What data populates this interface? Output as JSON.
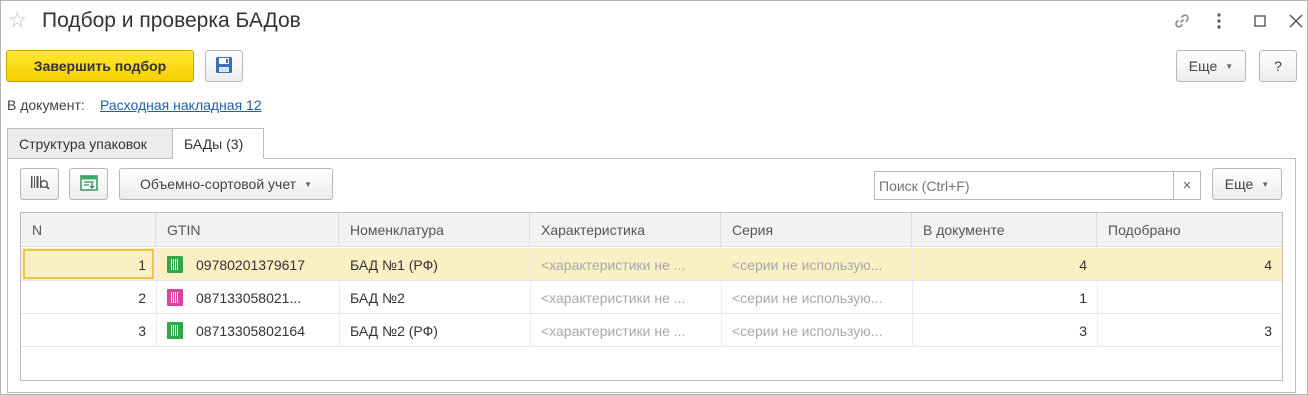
{
  "window": {
    "title": "Подбор и проверка БАДов"
  },
  "toolbar": {
    "finish_label": "Завершить подбор",
    "more_label": "Еще",
    "help_label": "?"
  },
  "document": {
    "label": "В документ:",
    "link": "Расходная накладная 12"
  },
  "tabs": [
    {
      "label": "Структура упаковок",
      "active": false
    },
    {
      "label": "БАДы (3)",
      "active": true
    }
  ],
  "panel_toolbar": {
    "mode_label": "Объемно-сортовой учет",
    "search_placeholder": "Поиск (Ctrl+F)",
    "clear_label": "×",
    "more_label": "Еще"
  },
  "table": {
    "columns": [
      "N",
      "GTIN",
      "Номенклатура",
      "Характеристика",
      "Серия",
      "В документе",
      "Подобрано"
    ],
    "rows": [
      {
        "n": "1",
        "gtin": "09780201379617",
        "mark_color": "#2ea84a",
        "nomenclature": "БАД №1 (РФ)",
        "characteristic": "<характеристики не ...",
        "series": "<серии не использую...",
        "in_document": "4",
        "picked": "4"
      },
      {
        "n": "2",
        "gtin": "087133058021...",
        "mark_color": "#d8459a",
        "nomenclature": "БАД №2",
        "characteristic": "<характеристики не ...",
        "series": "<серии не использую...",
        "in_document": "1",
        "picked": ""
      },
      {
        "n": "3",
        "gtin": "08713305802164",
        "mark_color": "#2ea84a",
        "nomenclature": "БАД №2 (РФ)",
        "characteristic": "<характеристики не ...",
        "series": "<серии не использую...",
        "in_document": "3",
        "picked": "3"
      }
    ]
  }
}
